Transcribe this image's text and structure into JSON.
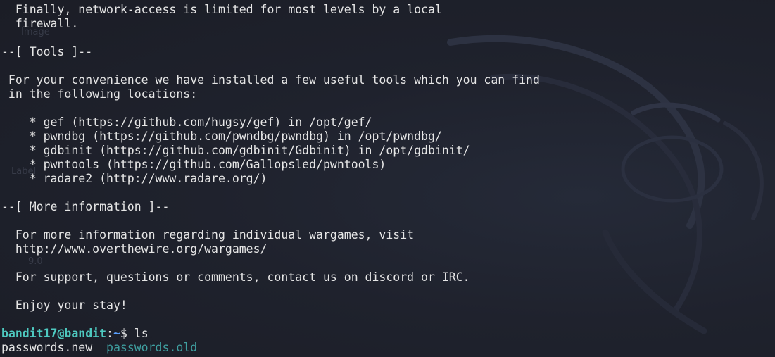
{
  "terminal": {
    "lines": [
      "  Finally, network-access is limited for most levels by a local",
      "  firewall.",
      "",
      "--[ Tools ]--",
      "",
      " For your convenience we have installed a few useful tools which you can find",
      " in the following locations:",
      "",
      "    * gef (https://github.com/hugsy/gef) in /opt/gef/",
      "    * pwndbg (https://github.com/pwndbg/pwndbg) in /opt/pwndbg/",
      "    * gdbinit (https://github.com/gdbinit/Gdbinit) in /opt/gdbinit/",
      "    * pwntools (https://github.com/Gallopsled/pwntools)",
      "    * radare2 (http://www.radare.org/)",
      "",
      "--[ More information ]--",
      "",
      "  For more information regarding individual wargames, visit",
      "  http://www.overthewire.org/wargames/",
      "",
      "  For support, questions or comments, contact us on discord or IRC.",
      "",
      "  Enjoy your stay!",
      ""
    ],
    "prompt": {
      "user_host": "bandit17@bandit",
      "colon": ":",
      "path": "~",
      "symbol": "$ ",
      "command": "ls"
    },
    "files": [
      {
        "name": "passwords.new",
        "color": "#e6e6e6"
      },
      {
        "name": "passwords.old",
        "color": "#3f9fa0"
      }
    ]
  },
  "background_ghost_text": {
    "image": "Image",
    "label": "Label",
    "version": "9.0"
  },
  "colors": {
    "background": "#1e2029",
    "text": "#e6e6e6",
    "prompt_user": "#4ec9c0",
    "prompt_path": "#5aa0ff"
  },
  "icons": [
    "kali-dragon-watermark"
  ]
}
